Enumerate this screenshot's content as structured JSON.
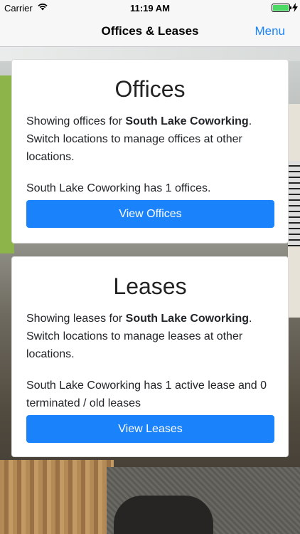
{
  "status_bar": {
    "carrier": "Carrier",
    "time": "11:19 AM",
    "battery_level": 1.0,
    "battery_color": "#4cd964"
  },
  "nav": {
    "title": "Offices & Leases",
    "menu_label": "Menu",
    "accent": "#1a82fb"
  },
  "offices": {
    "title": "Offices",
    "desc_prefix": "Showing offices for ",
    "location": "South Lake Coworking",
    "desc_suffix": ". Switch locations to manage offices at other locations.",
    "count_text": "South Lake Coworking has 1 offices.",
    "button_label": "View Offices"
  },
  "leases": {
    "title": "Leases",
    "desc_prefix": "Showing leases for ",
    "location": "South Lake Coworking",
    "desc_suffix": ". Switch locations to manage leases at other locations.",
    "count_text": "South Lake Coworking has 1 active lease and 0 terminated / old leases",
    "button_label": "View Leases"
  },
  "icons": [
    "wifi-icon",
    "battery-icon",
    "charging-bolt-icon"
  ]
}
